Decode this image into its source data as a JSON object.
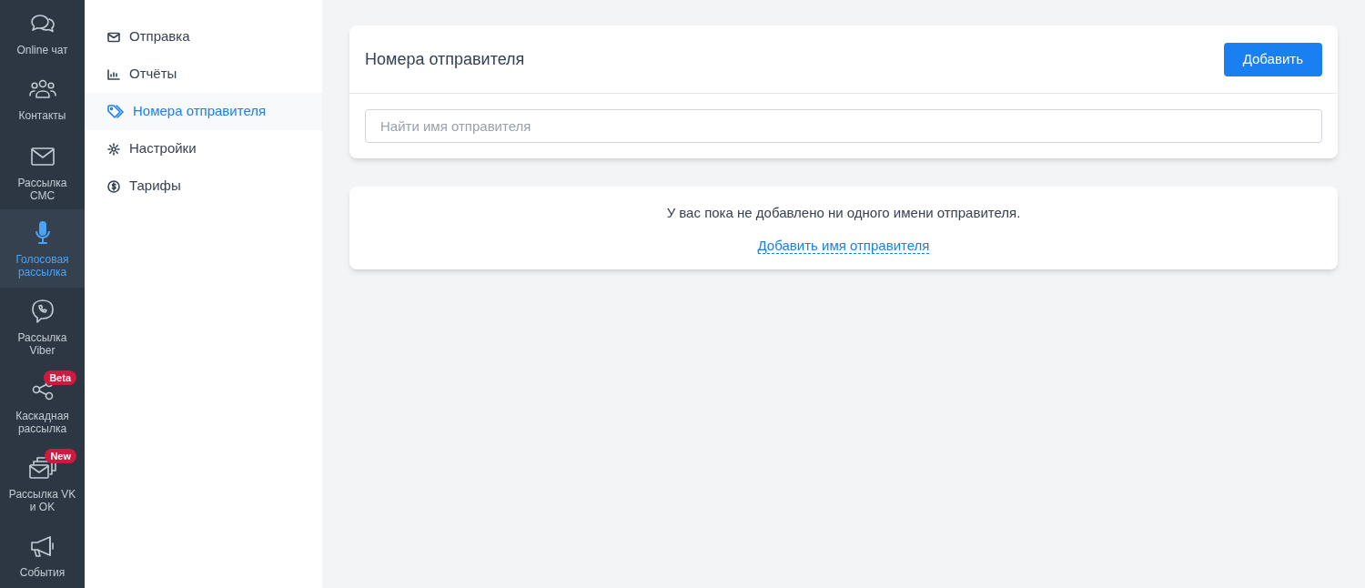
{
  "rail": [
    {
      "label": "Online чат",
      "selected": false
    },
    {
      "label": "Контакты",
      "selected": false
    },
    {
      "label": "Рассылка СМС",
      "selected": false
    },
    {
      "label": "Голосовая рассылка",
      "selected": true
    },
    {
      "label": "Рассылка Viber",
      "selected": false
    },
    {
      "label": "Каскадная рассылка",
      "selected": false,
      "badge": "Beta"
    },
    {
      "label": "Рассылка VK и OK",
      "selected": false,
      "badge": "New"
    },
    {
      "label": "События",
      "selected": false
    }
  ],
  "menu": [
    {
      "label": "Отправка",
      "selected": false
    },
    {
      "label": "Отчёты",
      "selected": false
    },
    {
      "label": "Номера отправителя",
      "selected": true
    },
    {
      "label": "Настройки",
      "selected": false
    },
    {
      "label": "Тарифы",
      "selected": false
    }
  ],
  "panel": {
    "title": "Номера отправителя",
    "add_button": "Добавить",
    "search": {
      "placeholder": "Найти имя отправителя"
    }
  },
  "empty": {
    "message": "У вас пока не добавлено ни одного имени отправителя.",
    "link": "Добавить имя отправителя"
  }
}
